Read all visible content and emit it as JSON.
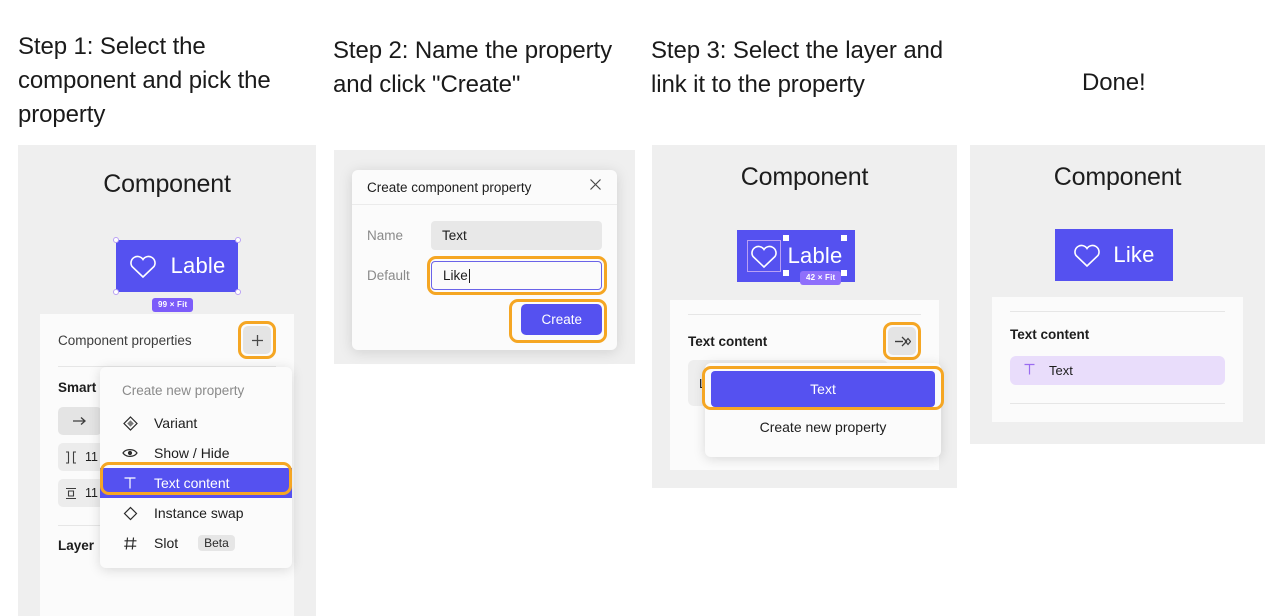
{
  "headings": {
    "step1": "Step 1: Select the component and pick the property",
    "step2": "Step 2: Name the property and click \"Create\"",
    "step3": "Step 3: Select the layer and link it to the property",
    "step4": "Done!"
  },
  "colors": {
    "accent_purple": "#5551f0",
    "highlight_orange": "#f5a623",
    "panel_background": "#efefef",
    "card_background": "#fbfbfb",
    "badge_purple": "#7c5cfa",
    "pill_lavender": "#e9ddfb"
  },
  "panel1": {
    "title": "Component",
    "button_label": "Lable",
    "button_icon": "heart-icon",
    "size_badge": "99 × Fit",
    "inspector": {
      "properties_label": "Component properties",
      "add_icon": "plus-icon",
      "smart_layout_label": "Smart layout",
      "layout_direction_icon": "arrow-right-icon",
      "spacing_rows": [
        {
          "icon": "horizontal-gap-icon",
          "value": "11"
        },
        {
          "icon": "vertical-padding-icon",
          "value": "11"
        }
      ],
      "layer_label": "Layer"
    },
    "menu": {
      "title": "Create new property",
      "items": [
        {
          "icon": "variant-diamond-icon",
          "label": "Variant",
          "active": false,
          "badge": ""
        },
        {
          "icon": "eye-icon",
          "label": "Show / Hide",
          "active": false,
          "badge": ""
        },
        {
          "icon": "text-t-icon",
          "label": "Text content",
          "active": true,
          "badge": ""
        },
        {
          "icon": "instance-swap-diamond-icon",
          "label": "Instance swap",
          "active": false,
          "badge": ""
        },
        {
          "icon": "hash-slot-icon",
          "label": "Slot",
          "active": false,
          "badge": "Beta"
        }
      ]
    }
  },
  "panel2": {
    "dialog_title": "Create component property",
    "close_icon": "close-icon",
    "fields": [
      {
        "label": "Name",
        "value": "Text",
        "focused": false
      },
      {
        "label": "Default",
        "value": "Like",
        "focused": true
      }
    ],
    "create_button": "Create"
  },
  "panel3": {
    "title": "Component",
    "button_label": "Lable",
    "button_icon": "heart-icon",
    "size_badge": "42 × Fit",
    "inspector": {
      "text_content_label": "Text content",
      "apply_property_icon": "apply-property-icon",
      "hidden_field_value": "Lable"
    },
    "menu": {
      "items": [
        {
          "label": "Text",
          "active": true
        },
        {
          "label": "Create new property",
          "active": false
        }
      ]
    }
  },
  "panel4": {
    "title": "Component",
    "button_label": "Like",
    "button_icon": "heart-icon",
    "inspector": {
      "text_content_label": "Text content",
      "property_pill": {
        "icon": "text-t-icon",
        "label": "Text"
      }
    }
  }
}
